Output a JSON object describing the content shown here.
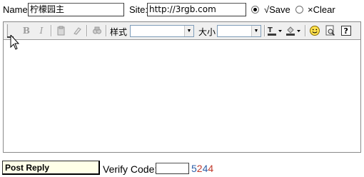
{
  "form": {
    "name_label": "Name:",
    "name_value": "柠檬园主",
    "site_label": "Site:",
    "site_value": "http://3rgb.com",
    "save_label": "√Save",
    "clear_label": "×Clear"
  },
  "toolbar": {
    "bold": "B",
    "italic": "I",
    "style_label": "样式",
    "size_label": "大小",
    "style_value": "",
    "size_value": ""
  },
  "footer": {
    "post_label": "Post Reply",
    "verify_label": "Verify Code:",
    "verify_input_value": "",
    "code_digits": [
      "5",
      "2",
      "4",
      "4"
    ]
  },
  "colors": {
    "code_digit_1": "#2e5fa8",
    "code_digit_2": "#c0392b",
    "code_digit_3": "#2e5fa8",
    "code_digit_4": "#c0392b",
    "post_button_bg": "#ffffe8"
  },
  "icons": [
    "cut-icon",
    "eraser-icon",
    "paste-icon",
    "find-icon",
    "text-color-icon",
    "background-color-icon",
    "smiley-icon",
    "preview-icon",
    "help-icon"
  ]
}
